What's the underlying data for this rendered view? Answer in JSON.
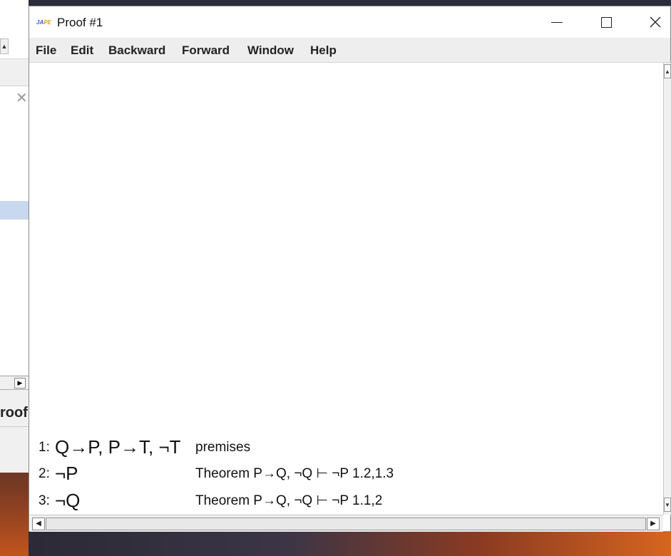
{
  "background": {
    "partial_label": "roof"
  },
  "window": {
    "title": "Proof #1",
    "icon_text": "JAPE"
  },
  "menu": [
    "File",
    "Edit",
    "Backward",
    "Forward",
    "Window",
    "Help"
  ],
  "proof": [
    {
      "num": "1:",
      "formula": "Q→P, P→T, ¬T",
      "justification": "premises"
    },
    {
      "num": "2:",
      "formula": "¬P",
      "justification": "Theorem P→Q, ¬Q ⊢ ¬P  1.2,1.3"
    },
    {
      "num": "3:",
      "formula": "¬Q",
      "justification": "Theorem P→Q, ¬Q ⊢ ¬P  1.1,2"
    }
  ]
}
